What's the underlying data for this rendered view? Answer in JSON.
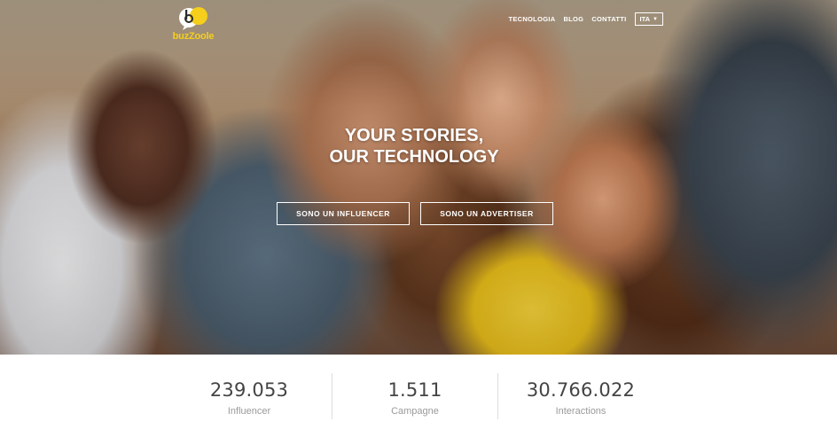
{
  "brand": {
    "name": "buzZoole",
    "colors": {
      "accent": "#f5cf1b",
      "text_dark": "#444444",
      "text_muted": "#9a9a9a"
    }
  },
  "nav": {
    "items": [
      {
        "label": "TECNOLOGIA"
      },
      {
        "label": "BLOG"
      },
      {
        "label": "CONTATTI"
      }
    ],
    "language": {
      "selected": "ITA",
      "icon": "chevron-down-icon"
    }
  },
  "hero": {
    "headline_line1": "YOUR STORIES,",
    "headline_line2": "OUR TECHNOLOGY",
    "cta_influencer": "SONO UN INFLUENCER",
    "cta_advertiser": "SONO UN ADVERTISER"
  },
  "stats": [
    {
      "value": "239.053",
      "label": "Influencer"
    },
    {
      "value": "1.511",
      "label": "Campagne"
    },
    {
      "value": "30.766.022",
      "label": "Interactions"
    }
  ]
}
